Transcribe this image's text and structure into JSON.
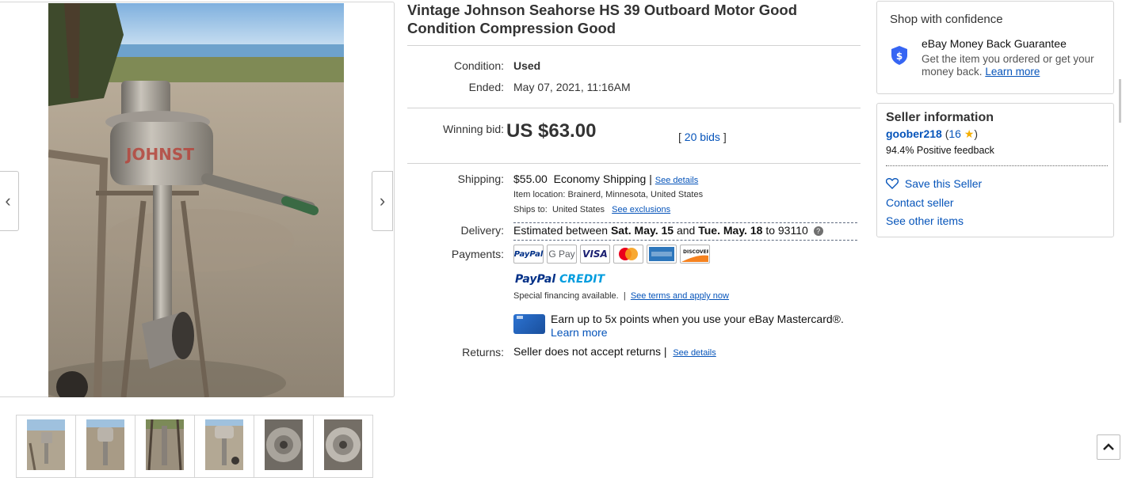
{
  "listing": {
    "title": "Vintage Johnson Seahorse HS 39 Outboard Motor Good Condition Compression Good"
  },
  "gallery": {
    "prev_arrow": "‹",
    "next_arrow": "›",
    "thumbnail_count": 6
  },
  "details": {
    "condition_label": "Condition:",
    "condition_value": "Used",
    "ended_label": "Ended:",
    "ended_value": "May 07, 2021, 11:16AM",
    "winning_bid_label": "Winning bid:",
    "winning_bid_value": "US $63.00",
    "bids_open": "[",
    "bids_link": "20 bids",
    "bids_close": "]",
    "shipping_label": "Shipping:",
    "shipping_cost": "$55.00",
    "shipping_method": "Economy Shipping",
    "shipping_sep": "|",
    "shipping_details_link": "See details",
    "item_location": "Item location: Brainerd, Minnesota, United States",
    "ships_to_label": "Ships to:",
    "ships_to_value": "United States",
    "see_exclusions_link": "See exclusions",
    "delivery_label": "Delivery:",
    "delivery_prefix": "Estimated between",
    "delivery_start": "Sat. May. 15",
    "delivery_and": "and",
    "delivery_end": "Tue. May. 18",
    "delivery_to": "to 93110",
    "delivery_help_icon": "question-circle-icon",
    "payments_label": "Payments:",
    "payment_logos": [
      "PayPal",
      "G Pay",
      "VISA",
      "Mastercard",
      "American Express",
      "Discover"
    ],
    "paypal_credit_paypal": "PayPal",
    "paypal_credit_credit": "CREDIT",
    "special_financing": "Special financing available.",
    "special_sep": "|",
    "see_terms_link": "See terms and apply now",
    "mastercard_promo": "Earn up to 5x points when you use your eBay Mastercard®.",
    "learn_more_link": "Learn more",
    "returns_label": "Returns:",
    "returns_value": "Seller does not accept returns",
    "returns_sep": "|",
    "returns_details_link": "See details"
  },
  "confidence": {
    "heading": "Shop with confidence",
    "guarantee_title": "eBay Money Back Guarantee",
    "guarantee_text": "Get the item you ordered or get your money back.",
    "guarantee_link": "Learn more",
    "shield_icon": "shield-dollar-icon"
  },
  "seller": {
    "heading": "Seller information",
    "username": "goober218",
    "feedback_open": "(",
    "feedback_score": "16",
    "feedback_close": ")",
    "positive_feedback": "94.4% Positive feedback",
    "save_seller": "Save this Seller",
    "contact_seller": "Contact seller",
    "see_other_items": "See other items"
  },
  "colors": {
    "link": "#0654ba",
    "shield": "#3665f3",
    "star": "#f5af02",
    "paypal_dark": "#003087",
    "paypal_light": "#009cde"
  }
}
